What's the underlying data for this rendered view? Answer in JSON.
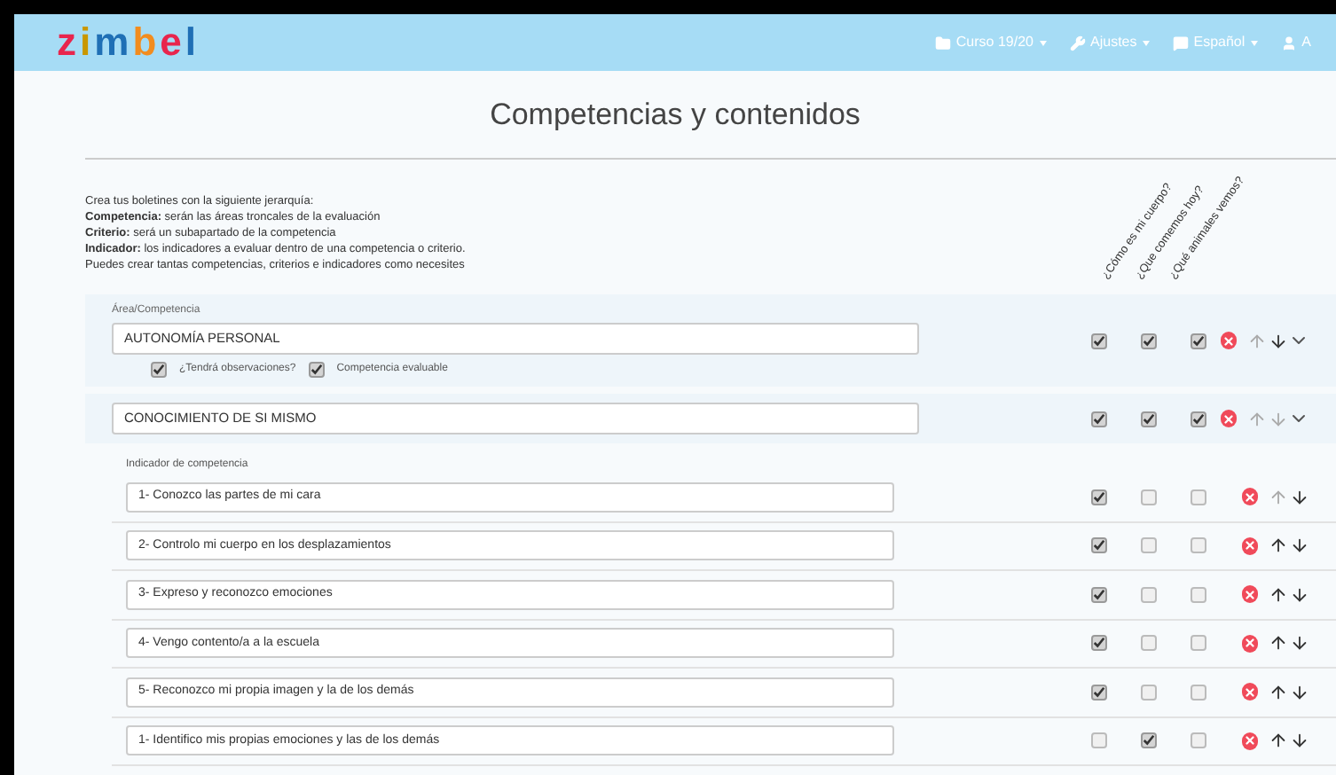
{
  "brand": {
    "letters": [
      {
        "text": "z",
        "color": "#e8254d"
      },
      {
        "text": "i",
        "color": "#c99700"
      },
      {
        "text": "m",
        "color": "#1f6fb5"
      },
      {
        "text": "b",
        "color": "#f28c1e"
      },
      {
        "text": "e",
        "color": "#e8254d"
      },
      {
        "text": "l",
        "color": "#1f6fb5"
      }
    ]
  },
  "nav": [
    {
      "kind": "folder",
      "label": "Curso 19/20",
      "caret": true
    },
    {
      "kind": "wrench",
      "label": "Ajustes",
      "caret": true
    },
    {
      "kind": "chat",
      "label": "Español",
      "caret": true
    },
    {
      "kind": "user",
      "label": "A",
      "caret": false
    }
  ],
  "page_title": "Competencias y contenidos",
  "intro": [
    "Crea tus boletines con la siguiente jerarquía:",
    "**Competencia:** serán las áreas troncales de la evaluación",
    "**Criterio:** será un subapartado de la competencia",
    "**Indicador:** los indicadores a evaluar dentro de una competencia o criterio.",
    "Puedes crear tantas competencias, criterios e indicadores como necesites"
  ],
  "columns": [
    "¿Cómo es mi cuerpo?",
    "¿Que comemos hoy?",
    "¿Qué animales vemos?"
  ],
  "competencies": [
    {
      "label": "Área/Competencia",
      "value": "AUTONOMÍA PERSONAL",
      "checks": [
        true,
        true,
        true
      ],
      "can_move_up": false,
      "can_move_down": true,
      "options": [
        {
          "label": "¿Tendrá observaciones?",
          "checked": true
        },
        {
          "label": "Competencia evaluable",
          "checked": true
        }
      ]
    },
    {
      "value": "CONOCIMIENTO DE SI MISMO",
      "checks": [
        true,
        true,
        true
      ],
      "can_move_up": false,
      "can_move_down": false
    }
  ],
  "indicators_label": "Indicador de competencia",
  "indicators": [
    {
      "value": "1- Conozco las partes de mi cara",
      "checks": [
        true,
        false,
        false
      ],
      "can_move_up": false,
      "can_move_down": true
    },
    {
      "value": "2- Controlo mi cuerpo en los desplazamientos",
      "checks": [
        true,
        false,
        false
      ],
      "can_move_up": true,
      "can_move_down": true
    },
    {
      "value": "3- Expreso y reconozco emociones",
      "checks": [
        true,
        false,
        false
      ],
      "can_move_up": true,
      "can_move_down": true
    },
    {
      "value": "4- Vengo contento/a a la escuela",
      "checks": [
        true,
        false,
        false
      ],
      "can_move_up": true,
      "can_move_down": true
    },
    {
      "value": "5- Reconozco mi propia imagen y la de los demás",
      "checks": [
        true,
        false,
        false
      ],
      "can_move_up": true,
      "can_move_down": true
    },
    {
      "value": "1- Identifico mis propias emociones y las de los demás",
      "checks": [
        false,
        true,
        false
      ],
      "can_move_up": true,
      "can_move_down": true
    }
  ]
}
